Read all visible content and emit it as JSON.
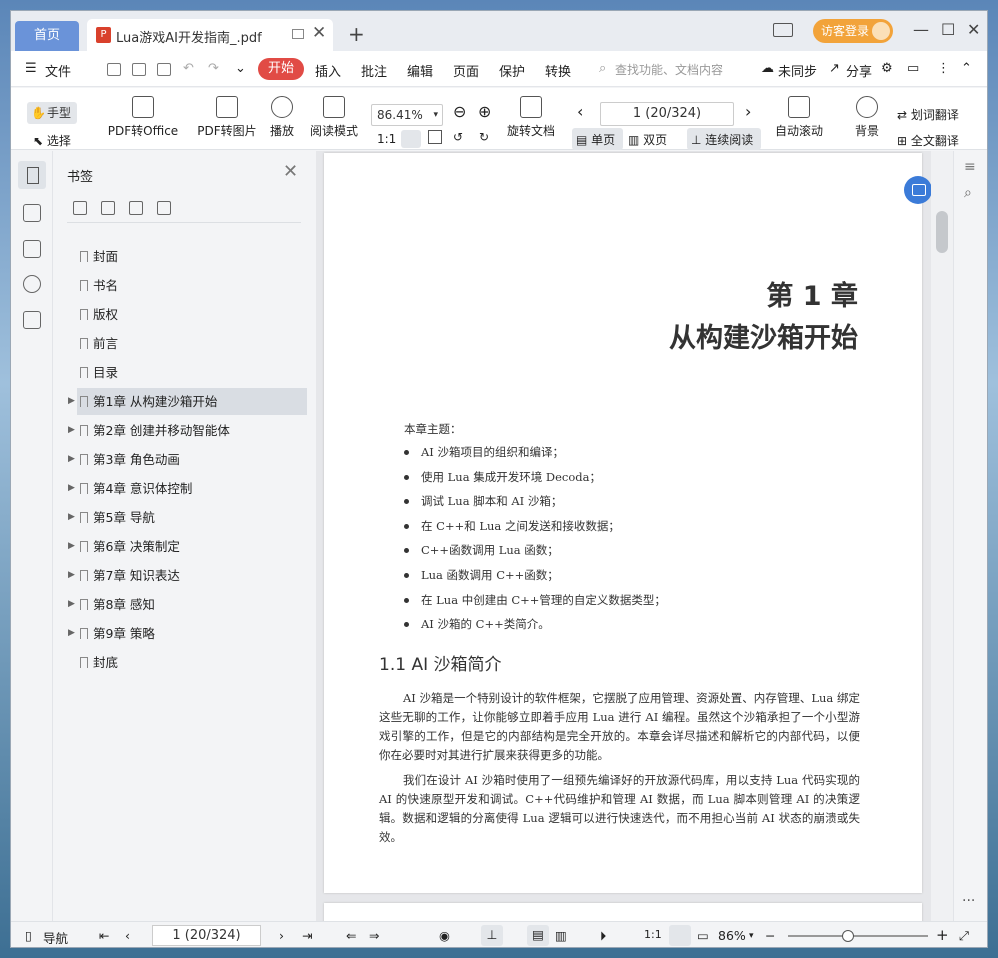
{
  "titlebar": {
    "home_tab": "首页",
    "doc_tab": "Lua游戏AI开发指南_.pdf",
    "pdf_icon": "P",
    "add_tab": "+",
    "login": "访客登录",
    "close_glyph": "✕"
  },
  "menubar": {
    "file": "文件",
    "start": "开始",
    "items": [
      "插入",
      "批注",
      "编辑",
      "页面",
      "保护",
      "转换"
    ],
    "search_placeholder": "查找功能、文档内容",
    "sync": "未同步",
    "share": "分享"
  },
  "toolbar": {
    "hand": "手型",
    "select": "选择",
    "pdf_to_office": "PDF转Office",
    "pdf_to_image": "PDF转图片",
    "play": "播放",
    "read_mode": "阅读模式",
    "zoom": "86.41%",
    "rotate": "旋转文档",
    "page_input": "1 (20/324)",
    "single": "单页",
    "double": "双页",
    "continuous": "连续阅读",
    "auto_scroll": "自动滚动",
    "background": "背景",
    "word_translate": "划词翻译",
    "full_translate": "全文翻译"
  },
  "bookmarks": {
    "title": "书签",
    "items": [
      {
        "label": "封面",
        "expandable": false
      },
      {
        "label": "书名",
        "expandable": false
      },
      {
        "label": "版权",
        "expandable": false
      },
      {
        "label": "前言",
        "expandable": false
      },
      {
        "label": "目录",
        "expandable": false
      },
      {
        "label": "第1章 从构建沙箱开始",
        "expandable": true
      },
      {
        "label": "第2章 创建并移动智能体",
        "expandable": true
      },
      {
        "label": "第3章 角色动画",
        "expandable": true
      },
      {
        "label": "第4章 意识体控制",
        "expandable": true
      },
      {
        "label": "第5章 导航",
        "expandable": true
      },
      {
        "label": "第6章 决策制定",
        "expandable": true
      },
      {
        "label": "第7章 知识表达",
        "expandable": true
      },
      {
        "label": "第8章 感知",
        "expandable": true
      },
      {
        "label": "第9章 策略",
        "expandable": true
      },
      {
        "label": "封底",
        "expandable": false
      }
    ],
    "active_index": 5
  },
  "page": {
    "chapter_number": "第 1 章",
    "chapter_title": "从构建沙箱开始",
    "topics_lead": "本章主题：",
    "topics": [
      "AI 沙箱项目的组织和编译；",
      "使用 Lua 集成开发环境 Decoda；",
      "调试 Lua 脚本和 AI 沙箱；",
      "在 C++和 Lua 之间发送和接收数据；",
      "C++函数调用 Lua 函数；",
      "Lua 函数调用 C++函数；",
      "在 Lua 中创建由 C++管理的自定义数据类型；",
      "AI 沙箱的 C++类简介。"
    ],
    "section": "1.1   AI 沙箱简介",
    "para1": "AI 沙箱是一个特别设计的软件框架，它摆脱了应用管理、资源处置、内存管理、Lua 绑定这些无聊的工作，让你能够立即着手应用 Lua 进行 AI 编程。虽然这个沙箱承担了一个小型游戏引擎的工作，但是它的内部结构是完全开放的。本章会详尽描述和解析它的内部代码，以便你在必要时对其进行扩展来获得更多的功能。",
    "para2": "我们在设计 AI 沙箱时使用了一组预先编译好的开放源代码库，用以支持 Lua 代码实现的 AI 的快速原型开发和调试。C++代码维护和管理 AI 数据，而 Lua 脚本则管理 AI 的决策逻辑。数据和逻辑的分离使得 Lua 逻辑可以进行快速迭代，而不用担心当前 AI 状态的崩溃或失效。"
  },
  "statusbar": {
    "nav": "导航",
    "page_input": "1 (20/324)",
    "zoom": "86%",
    "zoom_level": 0.4
  }
}
